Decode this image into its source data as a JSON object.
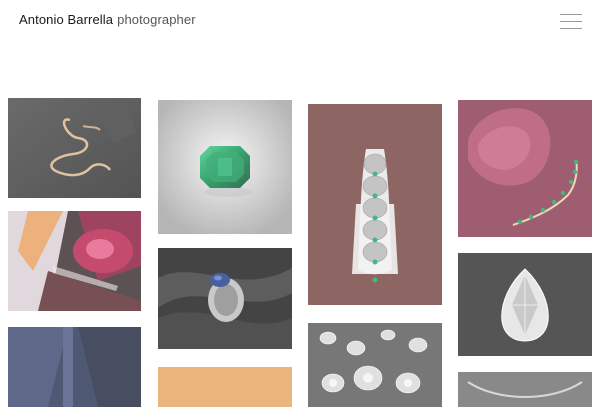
{
  "header": {
    "name": "Antonio Barrella",
    "role": "photographer",
    "menu_icon": "hamburger-menu-icon"
  },
  "gallery": {
    "items": [
      {
        "subject": "serpent necklace on slate"
      },
      {
        "subject": "colored glass prisms"
      },
      {
        "subject": "blue abstract"
      },
      {
        "subject": "emerald cut green gem"
      },
      {
        "subject": "sapphire ring on dark silk"
      },
      {
        "subject": "orange backdrop"
      },
      {
        "subject": "scalloped emerald brooch"
      },
      {
        "subject": "loose diamonds"
      },
      {
        "subject": "pink drape with emerald bracelet"
      },
      {
        "subject": "pear shaped diamond"
      },
      {
        "subject": "metal necklace on grey"
      }
    ]
  }
}
